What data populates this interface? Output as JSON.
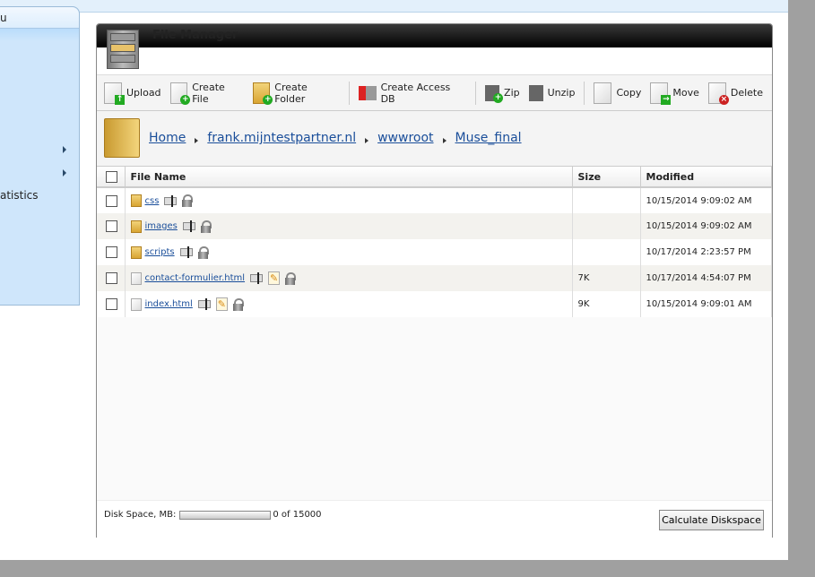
{
  "sidebar": {
    "header": "u",
    "items": [
      {
        "label": "",
        "has_submenu": true
      },
      {
        "label": "",
        "has_submenu": true
      },
      {
        "label": "atistics"
      }
    ]
  },
  "panel": {
    "title": "File Manager"
  },
  "toolbar": {
    "upload": "Upload",
    "create_file": "Create File",
    "create_folder": "Create Folder",
    "create_access_db": "Create Access DB",
    "zip": "Zip",
    "unzip": "Unzip",
    "copy": "Copy",
    "move": "Move",
    "delete": "Delete"
  },
  "breadcrumb": [
    "Home",
    "frank.mijntestpartner.nl",
    "wwwroot",
    "Muse_final"
  ],
  "table": {
    "headers": {
      "name": "File Name",
      "size": "Size",
      "modified": "Modified"
    },
    "rows": [
      {
        "name": "css",
        "type": "folder",
        "size": "",
        "modified": "10/15/2014 9:09:02 AM"
      },
      {
        "name": "images",
        "type": "folder",
        "size": "",
        "modified": "10/15/2014 9:09:02 AM"
      },
      {
        "name": "scripts",
        "type": "folder",
        "size": "",
        "modified": "10/17/2014 2:23:57 PM"
      },
      {
        "name": "contact-formulier.html",
        "type": "file",
        "size": "7K",
        "modified": "10/17/2014 4:54:07 PM"
      },
      {
        "name": "index.html",
        "type": "file",
        "size": "9K",
        "modified": "10/15/2014 9:09:01 AM"
      }
    ]
  },
  "footer": {
    "disk_label": "Disk Space, MB:",
    "disk_usage": "0 of 15000",
    "disk_used_fraction": 0,
    "calculate_button": "Calculate Diskspace"
  }
}
